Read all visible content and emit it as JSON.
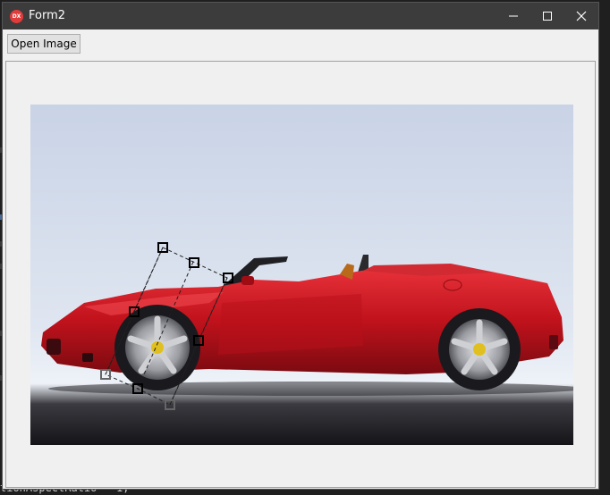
{
  "window": {
    "title": "Form2",
    "app_icon": "dx-icon"
  },
  "toolbar": {
    "open_image_label": "Open Image"
  },
  "background": {
    "code_text": "tionAspectRatio = 1;"
  },
  "photo": {
    "subject": "car-icon"
  },
  "colors": {
    "titlebar": "#3c3c3c",
    "car_body": "#c8141e",
    "backdrop": "#cfd8e6"
  }
}
